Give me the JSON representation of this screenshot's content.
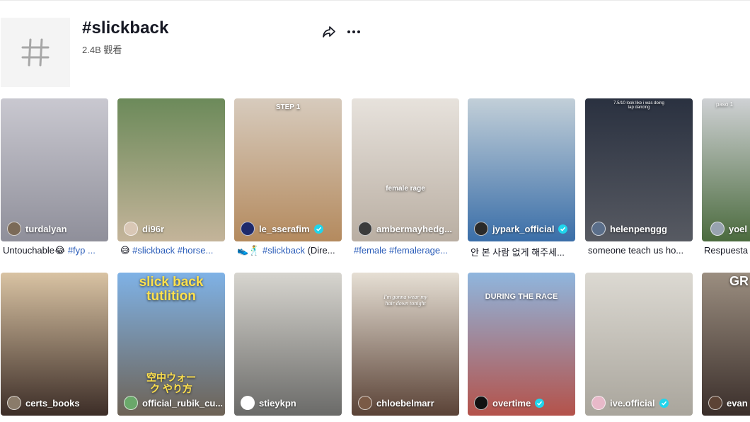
{
  "header": {
    "title": "#slickback",
    "views": "2.4B 觀看"
  },
  "row1": [
    {
      "user": "turdalyan",
      "caption_plain": "Untouchable😂 ",
      "caption_tags": "#fyp ...",
      "colors": [
        "#c9c8d0",
        "#8f8f9a"
      ]
    },
    {
      "user": "di96r",
      "caption_plain": "😅 ",
      "caption_tags": "#slickback #horse...",
      "colors": [
        "#6c8a5a",
        "#c4b49a"
      ]
    },
    {
      "user": "le_sserafim",
      "verified": true,
      "overlay": "STEP 1",
      "caption_plain": "👟🕺 ",
      "caption_tags": "#slickback",
      "caption_tail": " (Dire...",
      "colors": [
        "#d7cbbd",
        "#b48a5e"
      ]
    },
    {
      "user": "ambermayhedg...",
      "overlay": "female rage",
      "caption_tags": "#female #femalerage...",
      "colors": [
        "#e7e2dc",
        "#b9aea2"
      ]
    },
    {
      "user": "jypark_official",
      "verified": true,
      "caption_plain": "안 본 사람 없게 해주세...",
      "colors": [
        "#c2cfd8",
        "#3a6ea8"
      ]
    },
    {
      "user": "helenpenggg",
      "overlay": "7.5/10 look like i was doing tap dancing",
      "caption_plain": "someone teach us ho...",
      "colors": [
        "#2a3140",
        "#575a62"
      ]
    },
    {
      "user": "yoel_",
      "overlay": "paso 1",
      "caption_plain": "Respuesta",
      "colors": [
        "#cfd1d4",
        "#4b6b3e"
      ]
    }
  ],
  "row2": [
    {
      "user": "certs_books",
      "colors": [
        "#d9c3a3",
        "#3c2d27"
      ]
    },
    {
      "user": "official_rubik_cu...",
      "overlay": "slick back tutlition",
      "overlay2": "空中ウォーク やり方",
      "colors": [
        "#7fb2e6",
        "#6d6255"
      ]
    },
    {
      "user": "stieykpn",
      "colors": [
        "#d7d5cf",
        "#6a6a68"
      ]
    },
    {
      "user": "chloebelmarr",
      "overlay": "I'm gonna wear my hair down tonight",
      "colors": [
        "#e6dfd4",
        "#5a4236"
      ]
    },
    {
      "user": "overtime",
      "verified": true,
      "overlay": "DURING THE RACE",
      "colors": [
        "#8fb6de",
        "#b4524a"
      ]
    },
    {
      "user": "ive.official",
      "verified": true,
      "colors": [
        "#dcd9d2",
        "#a9a59c"
      ]
    },
    {
      "user": "evang",
      "overlay": "GR",
      "colors": [
        "#9b8e80",
        "#3a2e2a"
      ]
    }
  ]
}
